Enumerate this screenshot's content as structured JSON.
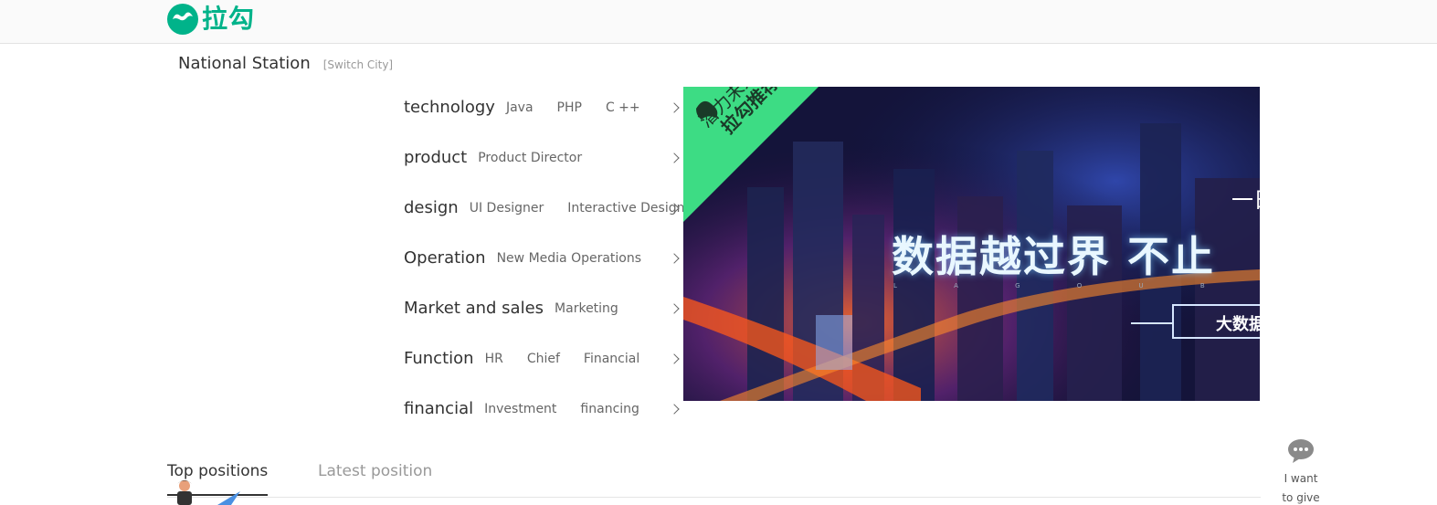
{
  "header": {
    "logo_text": "拉勾"
  },
  "station": {
    "name": "National Station",
    "switch_label": "[Switch City]"
  },
  "menu": {
    "rows": [
      {
        "title": "technology",
        "subs": [
          "Java",
          "PHP",
          "C ++"
        ]
      },
      {
        "title": "product",
        "subs": [
          "Product Director"
        ]
      },
      {
        "title": "design",
        "subs": [
          "UI Designer",
          "Interactive Design"
        ]
      },
      {
        "title": "Operation",
        "subs": [
          "New Media Operations"
        ]
      },
      {
        "title": "Market and sales",
        "subs": [
          "Marketing"
        ]
      },
      {
        "title": "Function",
        "subs": [
          "HR",
          "Chief",
          "Financial"
        ]
      },
      {
        "title": "financial",
        "subs": [
          "Investment",
          "financing"
        ]
      }
    ]
  },
  "banner": {
    "ribbon_line1": "潜力未来",
    "ribbon_line2": "拉勾推荐",
    "headline": "数据越过界 不止",
    "corner_text": "一日",
    "dots_text": "L A G O U B I G",
    "box_text": "大数据"
  },
  "tabs": {
    "active": "Top positions",
    "inactive": "Latest position"
  },
  "feedback": {
    "text": "I want to give"
  },
  "colors": {
    "brand": "#00b38a",
    "ribbon": "#3ddc84"
  }
}
